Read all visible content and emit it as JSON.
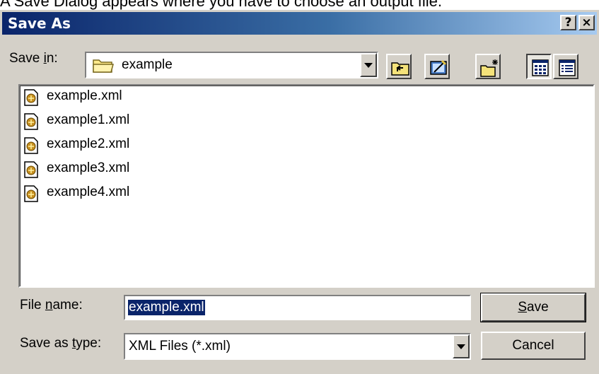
{
  "caption": "A Save Dialog appears where you have to choose an output file.",
  "window": {
    "title": "Save As",
    "help_glyph": "?",
    "close_glyph": "×"
  },
  "save_in": {
    "label_prefix": "Save ",
    "label_accel": "i",
    "label_suffix": "n:",
    "value": "example"
  },
  "toolbar": [
    "up-one-level",
    "desktop",
    "create-new-folder",
    "list-view",
    "details-view"
  ],
  "files": [
    {
      "name": "example.xml"
    },
    {
      "name": "example1.xml"
    },
    {
      "name": "example2.xml"
    },
    {
      "name": "example3.xml"
    },
    {
      "name": "example4.xml"
    }
  ],
  "file_name": {
    "label_prefix": "File ",
    "label_accel": "n",
    "label_suffix": "ame:",
    "value": "example.xml"
  },
  "save_as_type": {
    "label_prefix": "Save as ",
    "label_accel": "t",
    "label_suffix": "ype:",
    "value": "XML Files (*.xml)"
  },
  "buttons": {
    "save_accel": "S",
    "save_rest": "ave",
    "cancel": "Cancel"
  },
  "colors": {
    "titlebar_start": "#0a246a",
    "titlebar_end": "#a6caf0",
    "face": "#d4d0c8",
    "selection": "#0a246a"
  }
}
